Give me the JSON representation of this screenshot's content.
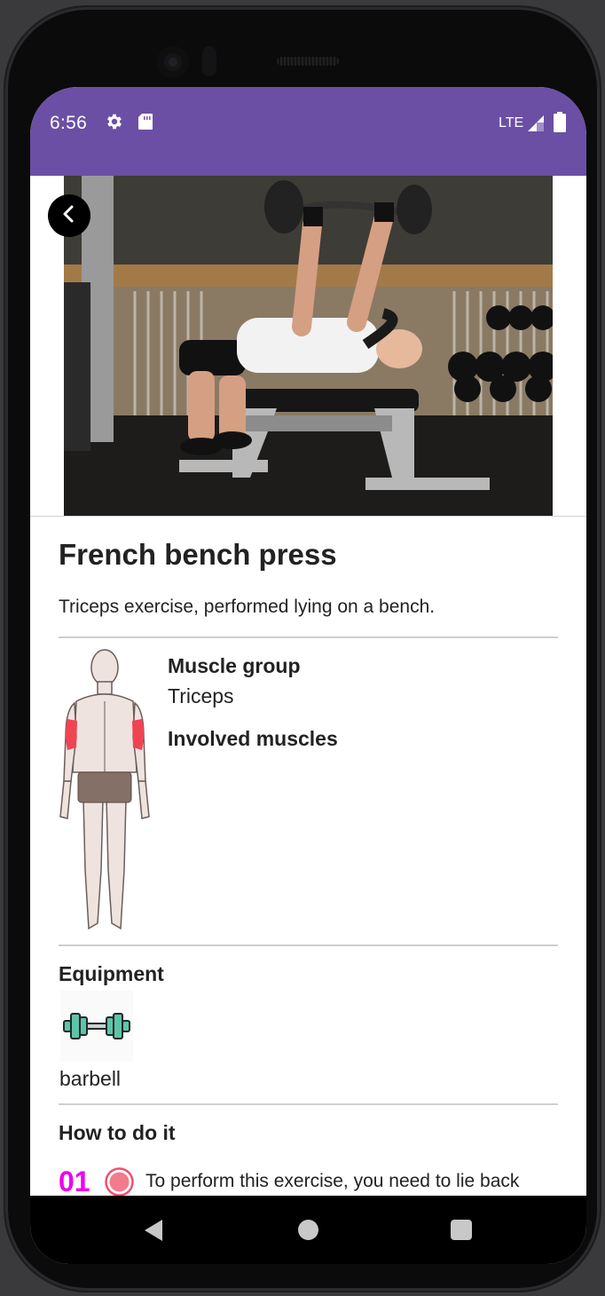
{
  "status_bar": {
    "time": "6:56",
    "network": "LTE",
    "background_color": "#6b4fa5"
  },
  "exercise": {
    "title": "French bench press",
    "description": "Triceps exercise, performed lying on a bench.",
    "muscle_group_heading": "Muscle group",
    "muscle_group": "Triceps",
    "involved_muscles_heading": "Involved muscles",
    "equipment_heading": "Equipment",
    "equipment_name": "barbell",
    "how_to_heading": "How to do it",
    "steps": [
      {
        "number": "01",
        "text": "To perform this exercise, you need to lie back"
      }
    ]
  },
  "colors": {
    "accent_step_number": "#ee00ee",
    "step_dot": "#f0506e",
    "highlighted_muscle": "#f04452",
    "equipment_icon": "#5ec4a8"
  },
  "icons": {
    "back": "chevron-left-icon",
    "settings": "gear-icon",
    "sd_card": "sd-card-icon",
    "signal": "signal-icon",
    "battery": "battery-icon"
  }
}
